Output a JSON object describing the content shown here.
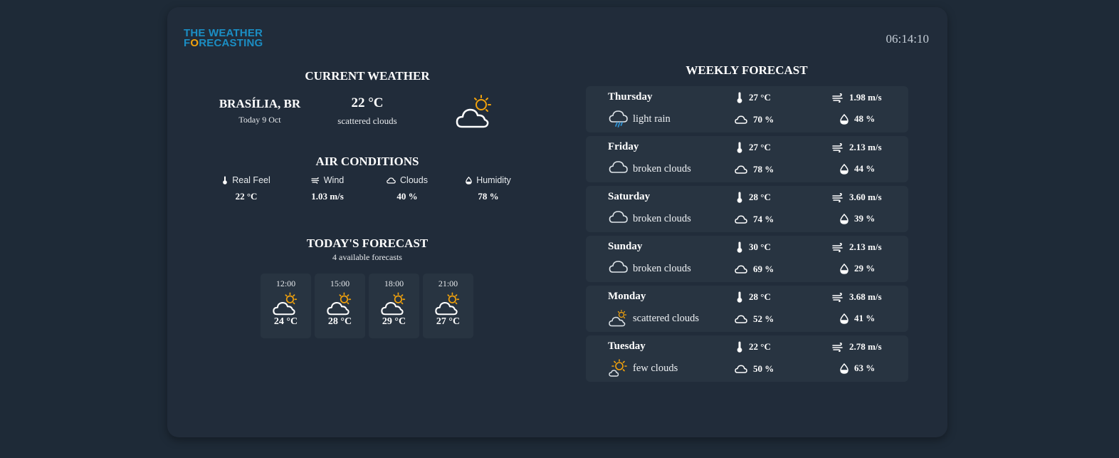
{
  "header": {
    "logo_line1": "THE WEATHER",
    "logo_line2_accent": "F",
    "logo_line2_o": "O",
    "logo_line2_rest": "RECASTING",
    "clock": "06:14:10"
  },
  "current_weather": {
    "title": "CURRENT WEATHER",
    "city": "BRASÍLIA, BR",
    "date": "Today 9 Oct",
    "temperature": "22 °C",
    "description": "scattered clouds",
    "icon": "partly-cloudy-sun-icon"
  },
  "air_conditions": {
    "title": "AIR CONDITIONS",
    "items": [
      {
        "label": "Real Feel",
        "value": "22 °C",
        "icon": "thermometer-icon"
      },
      {
        "label": "Wind",
        "value": "1.03 m/s",
        "icon": "wind-icon"
      },
      {
        "label": "Clouds",
        "value": "40 %",
        "icon": "cloud-icon"
      },
      {
        "label": "Humidity",
        "value": "78 %",
        "icon": "humidity-drop-icon"
      }
    ]
  },
  "todays_forecast": {
    "title": "TODAY'S FORECAST",
    "subtitle": "4 available forecasts",
    "items": [
      {
        "time": "12:00",
        "temp": "24 °C",
        "icon": "partly-cloudy-sun-icon"
      },
      {
        "time": "15:00",
        "temp": "28 °C",
        "icon": "partly-cloudy-sun-icon"
      },
      {
        "time": "18:00",
        "temp": "29 °C",
        "icon": "partly-cloudy-sun-icon"
      },
      {
        "time": "21:00",
        "temp": "27 °C",
        "icon": "partly-cloudy-sun-icon"
      }
    ]
  },
  "weekly_forecast": {
    "title": "WEEKLY FORECAST",
    "days": [
      {
        "day": "Thursday",
        "description": "light rain",
        "temp": "27 °C",
        "wind": "1.98 m/s",
        "clouds": "70 %",
        "humidity": "48 %",
        "icon": "rain-cloud-icon"
      },
      {
        "day": "Friday",
        "description": "broken clouds",
        "temp": "27 °C",
        "wind": "2.13 m/s",
        "clouds": "78 %",
        "humidity": "44 %",
        "icon": "cloud-icon"
      },
      {
        "day": "Saturday",
        "description": "broken clouds",
        "temp": "28 °C",
        "wind": "3.60 m/s",
        "clouds": "74 %",
        "humidity": "39 %",
        "icon": "cloud-icon"
      },
      {
        "day": "Sunday",
        "description": "broken clouds",
        "temp": "30 °C",
        "wind": "2.13 m/s",
        "clouds": "69 %",
        "humidity": "29 %",
        "icon": "cloud-icon"
      },
      {
        "day": "Monday",
        "description": "scattered clouds",
        "temp": "28 °C",
        "wind": "3.68 m/s",
        "clouds": "52 %",
        "humidity": "41 %",
        "icon": "partly-cloudy-sun-icon"
      },
      {
        "day": "Tuesday",
        "description": "few clouds",
        "temp": "22 °C",
        "wind": "2.78 m/s",
        "clouds": "50 %",
        "humidity": "63 %",
        "icon": "sun-small-cloud-icon"
      }
    ]
  },
  "colors": {
    "background": "#1e2a37",
    "card": "#212c3a",
    "tile": "#283441",
    "logo_blue": "#1b8ec4",
    "sun_orange": "#f2a20c"
  }
}
